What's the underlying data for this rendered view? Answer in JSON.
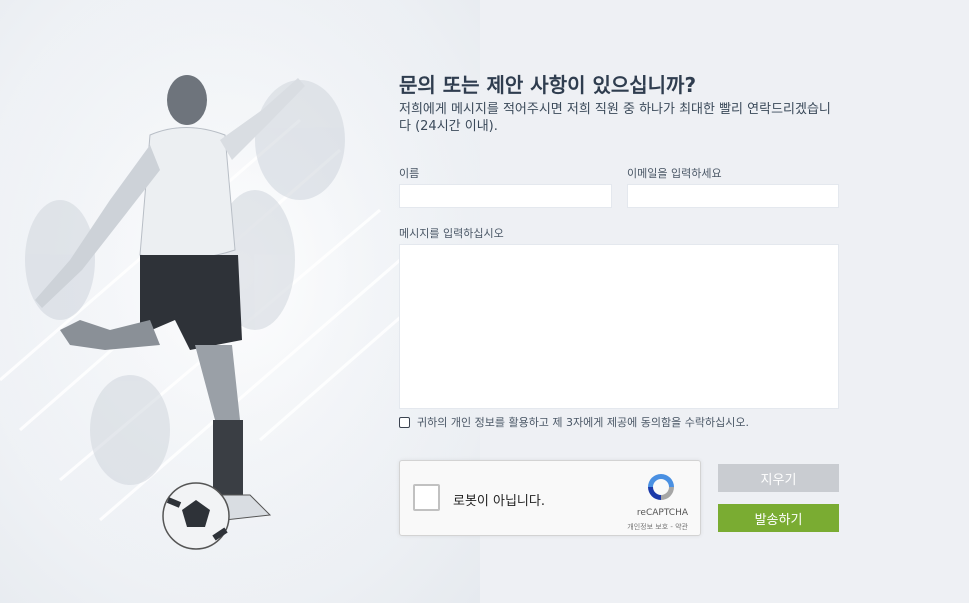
{
  "hero": {
    "image_alt": "soccer-player-kicking-ball"
  },
  "form": {
    "title": "문의 또는 제안 사항이 있으십니까?",
    "subtitle": "저희에게 메시지를 적어주시면 저희 직원 중 하나가 최대한 빨리 연락드리겠습니다 (24시간 이내).",
    "name_label": "이름",
    "name_value": "",
    "email_label": "이메일을 입력하세요",
    "email_value": "",
    "message_label": "메시지를 입력하십시오",
    "message_value": "",
    "consent_text": "귀하의 개인 정보를 활용하고 제 3자에게 제공에 동의함을 수락하십시오.",
    "consent_checked": false
  },
  "recaptcha": {
    "label": "로봇이 아닙니다.",
    "brand": "reCAPTCHA",
    "terms": "개인정보 보호 - 약관"
  },
  "buttons": {
    "clear_label": "지우기",
    "send_label": "발송하기"
  },
  "colors": {
    "send_button": "#7aac32",
    "clear_button": "#c9ccd1",
    "title": "#2f3d4f"
  }
}
